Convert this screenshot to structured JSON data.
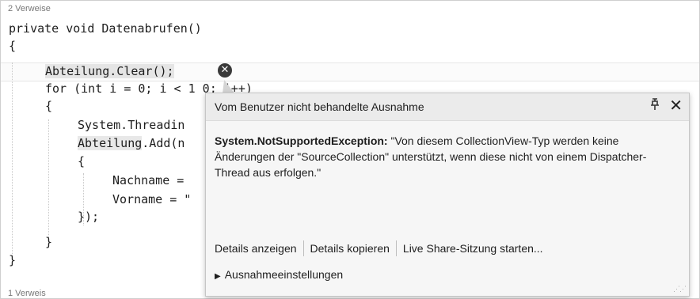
{
  "codelens_top": "2 Verweise",
  "codelens_bottom": "1 Verweis",
  "code": {
    "l1": "private void Datenabrufen()",
    "l2": "{",
    "l3a": "Abteilung.Clear();",
    "l4": "for (int i = 0; i < 1 0; i++)",
    "l5": "{",
    "l6": "System.Threadin",
    "l7a": "Abteilung",
    "l7b": ".Add(n",
    "l8": "{",
    "l9": "Nachname = ",
    "l10": "Vorname = \"",
    "l11": "});",
    "l12": "}",
    "l13": "}"
  },
  "popup": {
    "title": "Vom Benutzer nicht behandelte Ausnahme",
    "pin_glyph": "ꟷ",
    "exception_type": "System.NotSupportedException:",
    "message": " \"Von diesem CollectionView-Typ werden keine Änderungen der \"SourceCollection\" unterstützt, wenn diese nicht von einem Dispatcher-Thread aus erfolgen.\"",
    "link_details": "Details anzeigen",
    "link_copy": "Details kopieren",
    "link_liveshare": "Live Share-Sitzung starten...",
    "settings": "Ausnahmeeinstellungen"
  },
  "icons": {
    "error": "error-icon",
    "pin": "pin-icon",
    "close": "close-icon",
    "expand": "triangle-right-icon"
  }
}
